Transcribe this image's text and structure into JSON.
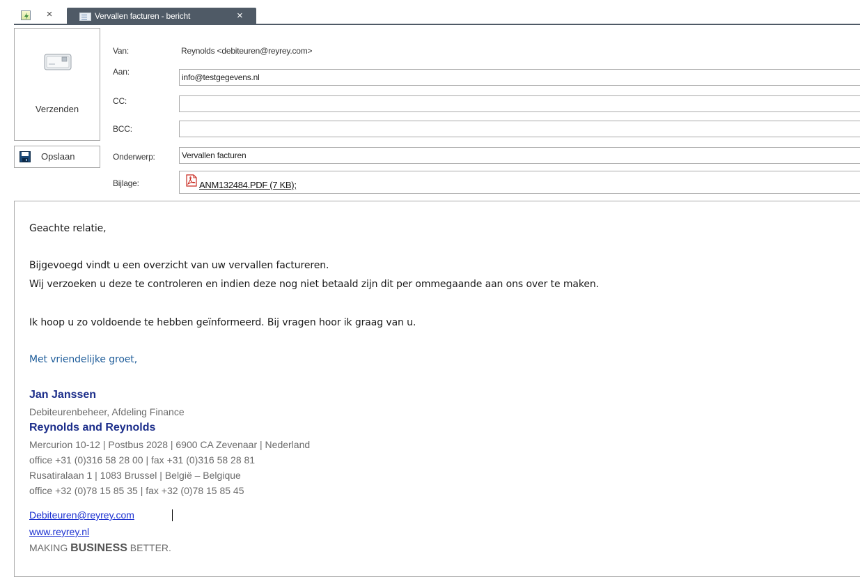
{
  "tabs": {
    "home_close": "×",
    "active_title": "Vervallen facturen - bericht",
    "active_close": "×"
  },
  "toolbar": {
    "send_label": "Verzenden",
    "save_label": "Opslaan"
  },
  "header": {
    "from_label": "Van:",
    "from_value": "Reynolds <debiteuren@reyrey.com>",
    "to_label": "Aan:",
    "to_value": "info@testgegevens.nl",
    "cc_label": "CC:",
    "cc_value": "",
    "bcc_label": "BCC:",
    "bcc_value": "",
    "subject_label": "Onderwerp:",
    "subject_value": "Vervallen facturen",
    "attachment_label": "Bijlage:",
    "attachment_value": "ANM132484.PDF (7 KB);"
  },
  "message": {
    "salutation": "Geachte relatie,",
    "line1": "Bijgevoegd vindt u een overzicht van uw vervallen factureren.",
    "line2": "Wij verzoeken u deze te controleren en indien deze nog niet betaald zijn dit per ommegaande aan ons over te maken.",
    "line3": "Ik hoop u zo voldoende te hebben geïnformeerd. Bij vragen hoor ik graag van u.",
    "closing": "Met vriendelijke groet,"
  },
  "signature": {
    "name": "Jan Janssen",
    "role": "Debiteurenbeheer, Afdeling Finance",
    "company": "Reynolds and Reynolds",
    "address_nl": "Mercurion 10-12 | Postbus 2028 | 6900 CA Zevenaar | Nederland",
    "phone_nl": "office +31 (0)316 58 28 00 | fax +31 (0)316 58 28 81",
    "address_be": "Rusatiralaan 1 | 1083 Brussel | België – Belgique",
    "phone_be": "office +32 (0)78 15 85 35 | fax +32 (0)78 15 85 45",
    "email": "Debiteuren@reyrey.com",
    "website": "www.reyrey.nl",
    "slogan_part1": "MAKING ",
    "slogan_part2": "BUSINESS",
    "slogan_part3": " BETTER."
  },
  "colors": {
    "tab_active": "#4f5a66",
    "signature_blue": "#1b2d8a",
    "link_blue": "#1a2fd0",
    "closing_blue": "#1f5d9a"
  },
  "icons": {
    "home_tab": "home-icon",
    "tab_doc": "mail-doc-icon",
    "send": "send-mail-icon",
    "save": "floppy-disk-icon",
    "attachment": "pdf-icon"
  }
}
